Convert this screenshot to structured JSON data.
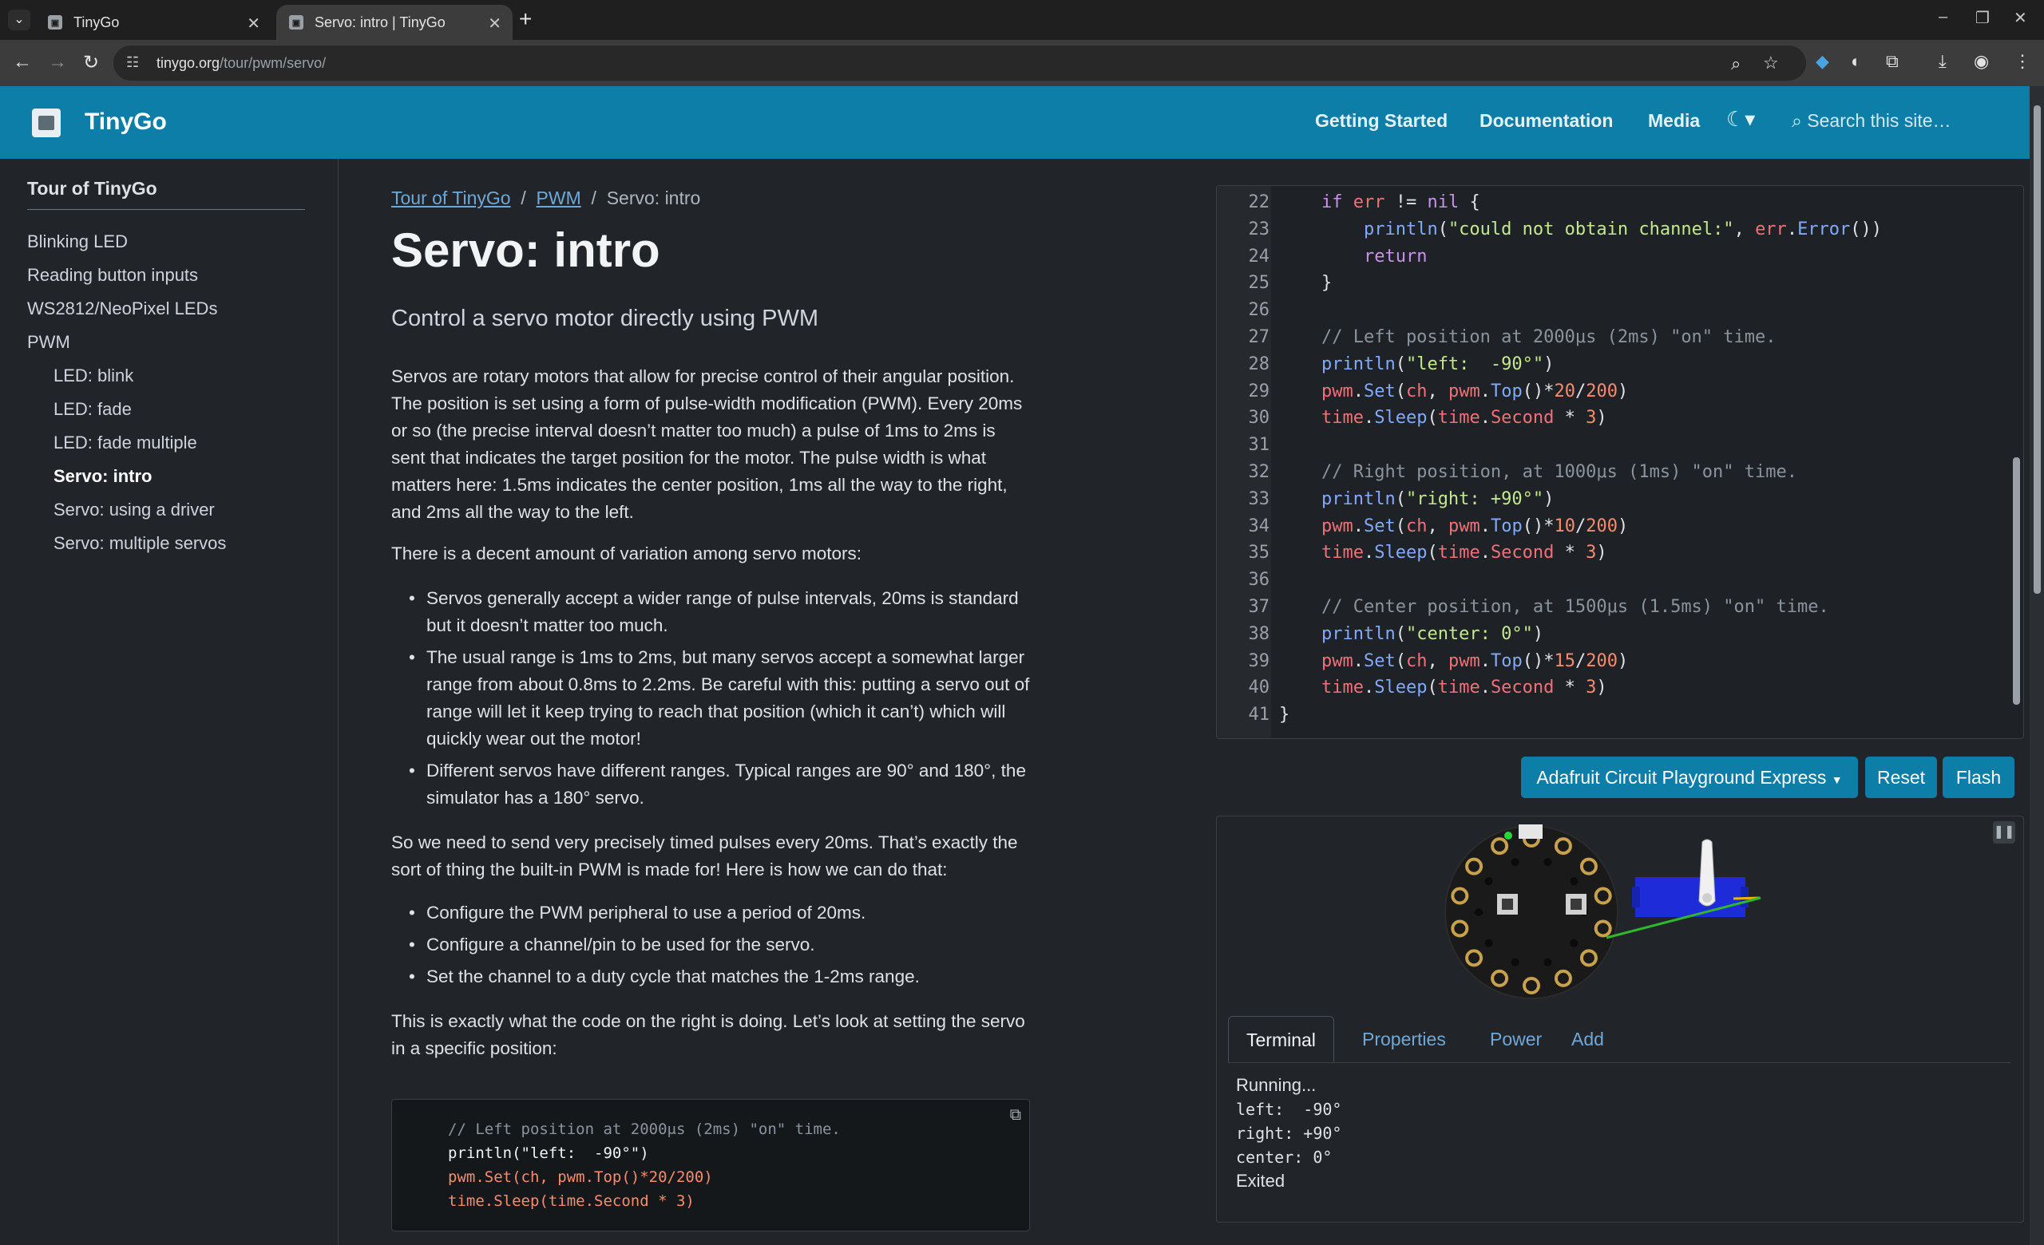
{
  "browser": {
    "tabs": [
      {
        "title": "TinyGo"
      },
      {
        "title": "Servo: intro | TinyGo"
      }
    ],
    "url_host": "tinygo.org",
    "url_path": "/tour/pwm/servo/"
  },
  "site": {
    "brand": "TinyGo",
    "nav": [
      "Getting Started",
      "Documentation",
      "Media"
    ],
    "search_placeholder": "Search this site…",
    "accent": "#0d7ea8"
  },
  "sidebar": {
    "title": "Tour of TinyGo",
    "items": [
      {
        "label": "Blinking LED"
      },
      {
        "label": "Reading button inputs"
      },
      {
        "label": "WS2812/NeoPixel LEDs"
      },
      {
        "label": "PWM"
      },
      {
        "label": "LED: blink"
      },
      {
        "label": "LED: fade"
      },
      {
        "label": "LED: fade multiple"
      },
      {
        "label": "Servo: intro"
      },
      {
        "label": "Servo: using a driver"
      },
      {
        "label": "Servo: multiple servos"
      }
    ]
  },
  "main": {
    "breadcrumb": [
      "Tour of TinyGo",
      "PWM",
      "Servo: intro"
    ],
    "title": "Servo: intro",
    "lead": "Control a servo motor directly using PWM",
    "p1": "Servos are rotary motors that allow for precise control of their angular position. The position is set using a form of pulse-width modification (PWM). Every 20ms or so (the precise interval doesn’t matter too much) a pulse of 1ms to 2ms is sent that indicates the target position for the motor. The pulse width is what matters here: 1.5ms indicates the center position, 1ms all the way to the right, and 2ms all the way to the left.",
    "p2": "There is a decent amount of variation among servo motors:",
    "list1": [
      "Servos generally accept a wider range of pulse intervals, 20ms is standard but it doesn’t matter too much.",
      "The usual range is 1ms to 2ms, but many servos accept a somewhat larger range from about 0.8ms to 2.2ms. Be careful with this: putting a servo out of range will let it keep trying to reach that position (which it can’t) which will quickly wear out the motor!",
      "Different servos have different ranges. Typical ranges are 90° and 180°, the simulator has a 180° servo."
    ],
    "p3": "So we need to send very precisely timed pulses every 20ms. That’s exactly the sort of thing the built-in PWM is made for! Here is how we can do that:",
    "list2": [
      "Configure the PWM peripheral to use a period of 20ms.",
      "Configure a channel/pin to be used for the servo.",
      "Set the channel to a duty cycle that matches the 1-2ms range."
    ],
    "p4": "This is exactly what the code on the right is doing. Let’s look at setting the servo in a specific position:",
    "snippet": [
      "// Left position at 2000μs (2ms) \"on\" time.",
      "println(\"left:  -90°\")",
      "pwm.Set(ch, pwm.Top()*20/200)",
      "time.Sleep(time.Second * 3)"
    ]
  },
  "editor": {
    "first_line": 22,
    "lines": [
      "    if err != nil {",
      "        println(\"could not obtain channel:\", err.Error())",
      "        return",
      "    }",
      "",
      "    // Left position at 2000μs (2ms) \"on\" time.",
      "    println(\"left:  -90°\")",
      "    pwm.Set(ch, pwm.Top()*20/200)",
      "    time.Sleep(time.Second * 3)",
      "",
      "    // Right position, at 1000μs (1ms) \"on\" time.",
      "    println(\"right: +90°\")",
      "    pwm.Set(ch, pwm.Top()*10/200)",
      "    time.Sleep(time.Second * 3)",
      "",
      "    // Center position, at 1500μs (1.5ms) \"on\" time.",
      "    println(\"center: 0°\")",
      "    pwm.Set(ch, pwm.Top()*15/200)",
      "    time.Sleep(time.Second * 3)",
      "}"
    ]
  },
  "controls": {
    "board": "Adafruit Circuit Playground Express",
    "reset": "Reset",
    "flash": "Flash"
  },
  "simulator": {
    "tabs": [
      "Terminal",
      "Properties",
      "Power",
      "Add"
    ],
    "terminal": {
      "status_start": "Running...",
      "output": [
        "left:  -90°",
        "right: +90°",
        "center: 0°"
      ],
      "status_end": "Exited"
    }
  }
}
